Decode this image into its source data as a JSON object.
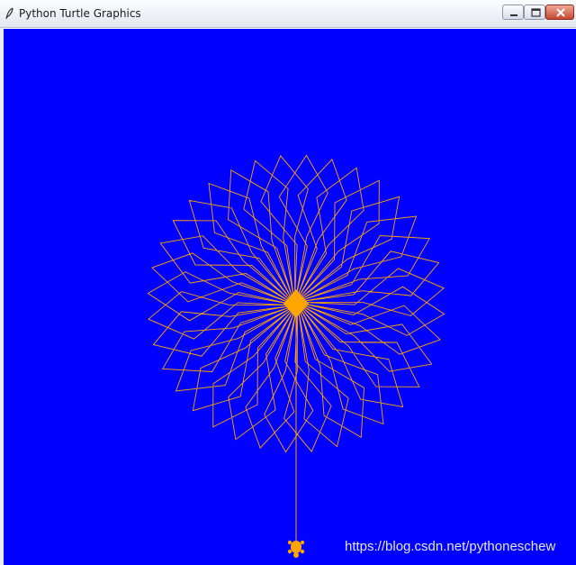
{
  "window": {
    "title": "Python Turtle Graphics",
    "icon": "feather-quill-icon",
    "controls": [
      "minimize-icon",
      "maximize-icon",
      "close-icon"
    ]
  },
  "canvas": {
    "background_color": "#0000ff",
    "pen_color": "#ffa500",
    "drawing": "starburst rosette of orange zigzag rays around a filled center diamond, with a vertical line down to the turtle cursor"
  },
  "watermark": {
    "text": "https://blog.csdn.net/pythoneschew"
  }
}
